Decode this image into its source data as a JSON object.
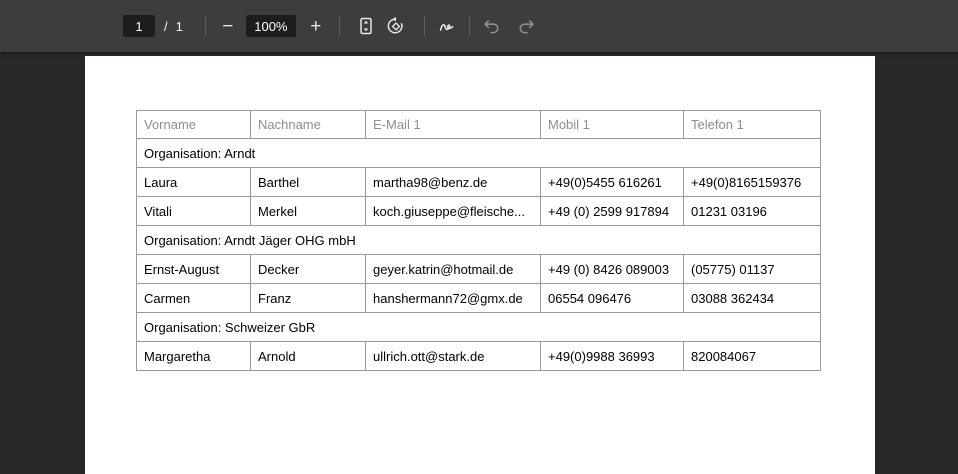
{
  "toolbar": {
    "page_current": "1",
    "page_separator": "/",
    "page_total": "1",
    "zoom_out_icon": "−",
    "zoom_level": "100%",
    "zoom_in_icon": "+",
    "icons": [
      "zoom-out-icon",
      "zoom-in-icon",
      "fit-page-icon",
      "rotate-ccw-icon",
      "annotate-icon",
      "undo-icon",
      "redo-icon"
    ]
  },
  "colors": {
    "toolbar_bg": "#3d3d3d",
    "canvas_bg": "#282828",
    "field_bg": "#1d1d1d",
    "toolbar_text": "#f1f1f1",
    "table_border": "#999999",
    "header_text": "#8e8e8e",
    "body_text": "#000000",
    "page_bg": "#ffffff"
  },
  "table": {
    "headers": [
      "Vorname",
      "Nachname",
      "E-Mail 1",
      "Mobil 1",
      "Telefon 1"
    ],
    "rows": [
      {
        "type": "group",
        "label": "Organisation: Arndt"
      },
      {
        "type": "data",
        "cells": [
          "Laura",
          "Barthel",
          "martha98@benz.de",
          "+49(0)5455 616261",
          "+49(0)8165159376"
        ]
      },
      {
        "type": "data",
        "cells": [
          "Vitali",
          "Merkel",
          "koch.giuseppe@fleische...",
          "+49 (0) 2599 917894",
          "01231 03196"
        ]
      },
      {
        "type": "group",
        "label": "Organisation: Arndt Jäger OHG mbH"
      },
      {
        "type": "data",
        "cells": [
          "Ernst-August",
          "Decker",
          "geyer.katrin@hotmail.de",
          "+49 (0) 8426 089003",
          "(05775) 01137"
        ]
      },
      {
        "type": "data",
        "cells": [
          "Carmen",
          "Franz",
          "hanshermann72@gmx.de",
          "06554 096476",
          "03088 362434"
        ]
      },
      {
        "type": "group",
        "label": "Organisation: Schweizer GbR"
      },
      {
        "type": "data",
        "cells": [
          "Margaretha",
          "Arnold",
          "ullrich.ott@stark.de",
          "+49(0)9988 36993",
          "820084067"
        ]
      }
    ]
  }
}
